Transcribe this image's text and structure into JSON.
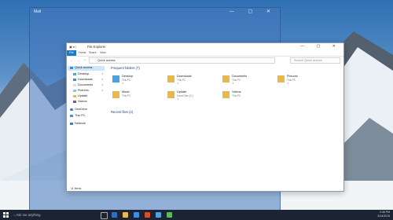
{
  "mail": {
    "title": "Mail",
    "controls": "— ▢ ✕"
  },
  "explorer": {
    "title": "File Explorer",
    "window_controls": "— ▢ ✕",
    "ribbon": [
      "File",
      "Home",
      "Share",
      "View"
    ],
    "address": "Quick access",
    "search_placeholder": "Search Quick access",
    "frequent_header": "Frequent folders (7)",
    "recent_header": "Recent files (4)",
    "status": "11 items",
    "nav": [
      "Quick access",
      "Desktop",
      "Downloads",
      "Documents",
      "Pictures",
      "Update",
      "Videos",
      "OneDrive",
      "This PC",
      "Network"
    ],
    "folders": [
      {
        "name": "Desktop",
        "location": "This PC",
        "color": "#4aa3e0"
      },
      {
        "name": "Downloads",
        "location": "This PC",
        "color": "#e8b84a"
      },
      {
        "name": "Documents",
        "location": "This PC",
        "color": "#e8b84a"
      },
      {
        "name": "Pictures",
        "location": "This PC",
        "color": "#e8b84a"
      },
      {
        "name": "Music",
        "location": "This PC",
        "color": "#e8b84a"
      },
      {
        "name": "Update",
        "location": "Local Disk (C:)",
        "color": "#e8b84a"
      },
      {
        "name": "Videos",
        "location": "This PC",
        "color": "#e8b84a"
      }
    ]
  },
  "taskbar": {
    "search": "Ask me anything",
    "time": "2:46 PM",
    "date": "3/14/2015",
    "accent": "#1c2433"
  }
}
